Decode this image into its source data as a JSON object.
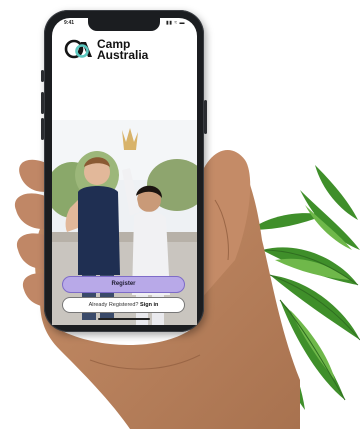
{
  "status_bar": {
    "time": "9:41",
    "icons": "▪▪ ≈ ▬"
  },
  "app": {
    "brand_line1": "Camp",
    "brand_line2": "Australia"
  },
  "actions": {
    "register_label": "Register",
    "signin_prompt": "Already Registered?",
    "signin_link": "Sign in"
  },
  "colors": {
    "accent": "#b8a9e8",
    "accent_border": "#7e6cc8",
    "logo_teal": "#5cc8c0",
    "logo_black": "#151515"
  },
  "icons": [
    "camp-australia-logo",
    "signal-icon",
    "wifi-icon",
    "battery-icon"
  ]
}
